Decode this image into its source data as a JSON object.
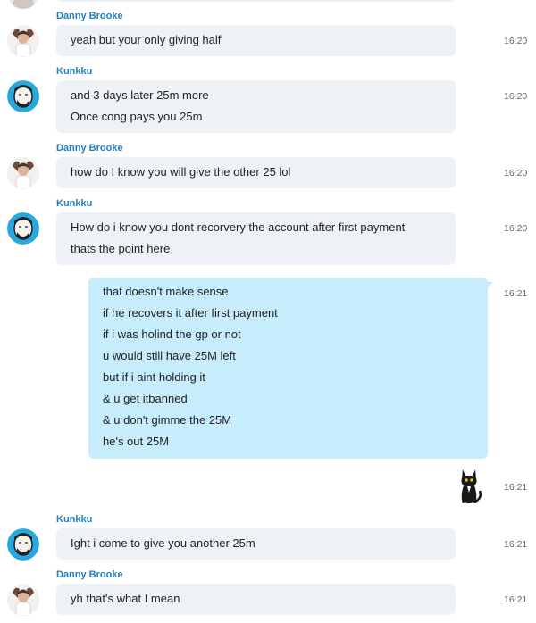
{
  "messages": [
    {
      "sender": "Danny Brooke",
      "time": "16:20",
      "lines": [
        "yeah but your only giving half"
      ]
    },
    {
      "sender": "Kunkku",
      "time": "16:20",
      "lines": [
        "and 3 days later 25m more",
        "Once cong pays you 25m"
      ]
    },
    {
      "sender": "Danny Brooke",
      "time": "16:20",
      "lines": [
        "how do I know you will give the other 25 lol"
      ]
    },
    {
      "sender": "Kunkku",
      "time": "16:20",
      "lines": [
        "How do i know you dont recorvery the account after first payment",
        "thats the point here"
      ]
    },
    {
      "sender": "",
      "time": "16:21",
      "lines": [
        "that doesn't make sense",
        "if he recovers it after first payment",
        "if i was holind the gp or not",
        "u would still have 25M left",
        "but if i aint holding it",
        "& u get itbanned",
        "& u don't gimme the 25M",
        "he's out 25M"
      ]
    },
    {
      "sender": "",
      "time": "16:21",
      "sticker": "black-cat-sticker"
    },
    {
      "sender": "Kunkku",
      "time": "16:21",
      "lines": [
        "Ight i come to give you another 25m"
      ]
    },
    {
      "sender": "Danny Brooke",
      "time": "16:21",
      "lines": [
        "yh that's what I mean"
      ]
    }
  ],
  "colors": {
    "incoming_bubble": "#eef1f6",
    "outgoing_bubble": "#c7ecfc",
    "sender_name": "#1f7fbf",
    "timestamp": "#666666"
  }
}
